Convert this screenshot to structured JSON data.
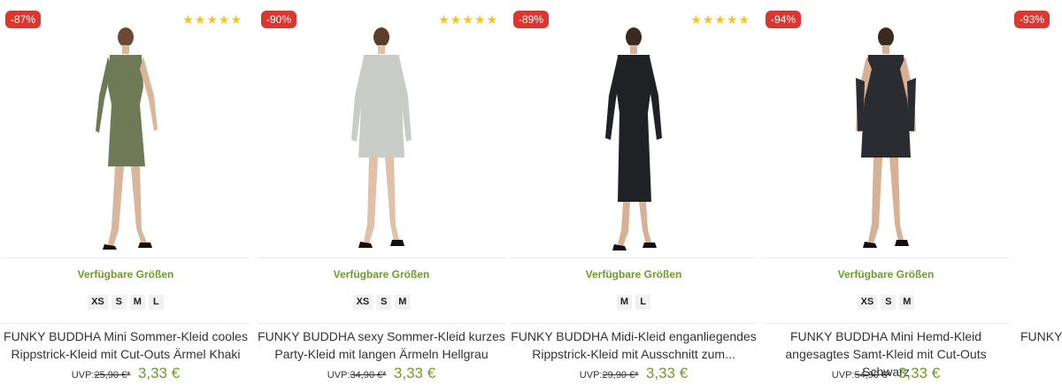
{
  "products": [
    {
      "discount": "-87%",
      "rating_stars": 5,
      "sizes_heading": "Verfügbare Größen",
      "sizes": [
        "XS",
        "S",
        "M",
        "L"
      ],
      "title_line1": "FUNKY BUDDHA Mini Sommer-Kleid cooles",
      "title_line2": "Rippstrick-Kleid mit Cut-Outs Ärmel Khaki",
      "uvp_label": "UVP:",
      "old_price": "25,90 €*",
      "price": "3,33 €",
      "dress_color": "#6e7a56"
    },
    {
      "discount": "-90%",
      "rating_stars": 5,
      "sizes_heading": "Verfügbare Größen",
      "sizes": [
        "XS",
        "S",
        "M"
      ],
      "title_line1": "FUNKY BUDDHA sexy Sommer-Kleid kurzes",
      "title_line2": "Party-Kleid mit langen Ärmeln Hellgrau",
      "uvp_label": "UVP:",
      "old_price": "34,90 €*",
      "price": "3,33 €",
      "dress_color": "#c9ccc6"
    },
    {
      "discount": "-89%",
      "rating_stars": 5,
      "sizes_heading": "Verfügbare Größen",
      "sizes": [
        "M",
        "L"
      ],
      "title_line1": "FUNKY BUDDHA Midi-Kleid enganliegendes",
      "title_line2": "Rippstrick-Kleid mit Ausschnitt zum...",
      "uvp_label": "UVP:",
      "old_price": "29,90 €*",
      "price": "3,33 €",
      "dress_color": "#1f2124"
    },
    {
      "discount": "-94%",
      "rating_stars": 0,
      "sizes_heading": "Verfügbare Größen",
      "sizes": [
        "XS",
        "S",
        "M"
      ],
      "title_line1": "FUNKY BUDDHA Mini Hemd-Kleid",
      "title_line2": "angesagtes Samt-Kleid mit Cut-Outs Schwarz",
      "uvp_label": "UVP:",
      "old_price": "54,90 €*",
      "price": "3,33 €",
      "dress_color": "#2a2c31"
    }
  ],
  "partial_product": {
    "discount": "-93%",
    "title": "FUNKY"
  },
  "colors": {
    "badge": "#d9372f",
    "star": "#f5c518",
    "price_green": "#6f9b2e"
  }
}
